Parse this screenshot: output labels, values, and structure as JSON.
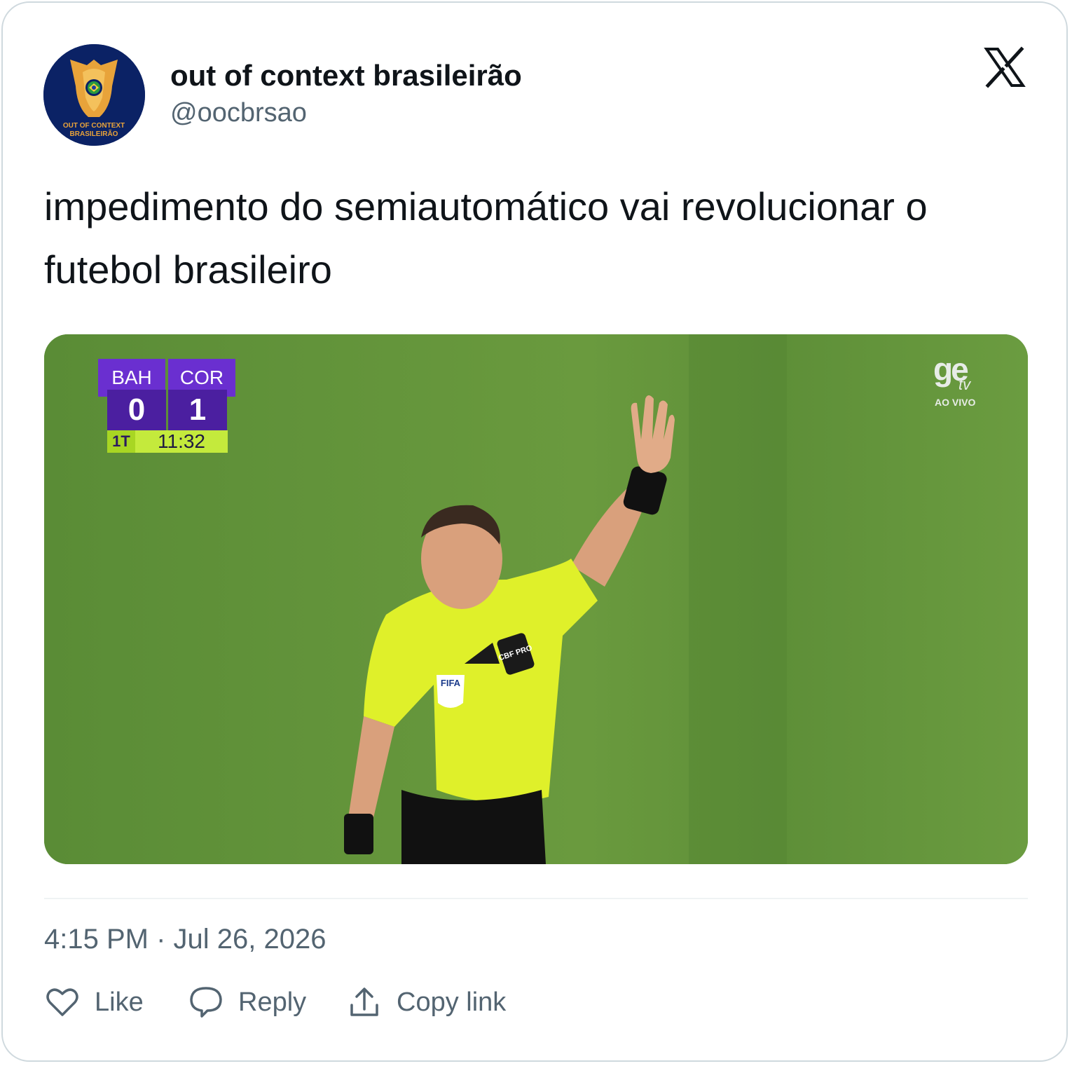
{
  "author": {
    "display_name": "out of context brasileirão",
    "handle": "@oocbrsao",
    "avatar_caption_line1": "OUT OF CONTEXT",
    "avatar_caption_line2": "BRASILEIRÃO"
  },
  "tweet": {
    "text": "impedimento do semiautomático vai revolucionar o futebol brasileiro",
    "timestamp": "4:15 PM · Jul 26, 2026"
  },
  "media": {
    "scoreboard": {
      "home_team": "BAH",
      "away_team": "COR",
      "home_score": "0",
      "away_score": "1",
      "period": "1T",
      "clock": "11:32"
    },
    "broadcaster": {
      "logo_text": "ge",
      "sub_text": "tv",
      "live_text": "AO VIVO"
    },
    "badges": {
      "cbf": "CBF PRO",
      "fifa": "FIFA"
    }
  },
  "actions": {
    "like": "Like",
    "reply": "Reply",
    "copy_link": "Copy link"
  },
  "icons": {
    "brand": "x-logo-icon",
    "like": "heart-icon",
    "reply": "speech-bubble-icon",
    "copy_link": "share-upload-icon"
  },
  "colors": {
    "text_primary": "#0f1419",
    "text_secondary": "#536471",
    "border": "#cfd9de",
    "avatar_bg": "#0b2265",
    "avatar_gold": "#e8a33a",
    "scoreboard_purple": "#6a2fd0",
    "scoreboard_green": "#c4ea3c",
    "pitch_green": "#5d8f3a",
    "referee_shirt": "#dff02a"
  }
}
